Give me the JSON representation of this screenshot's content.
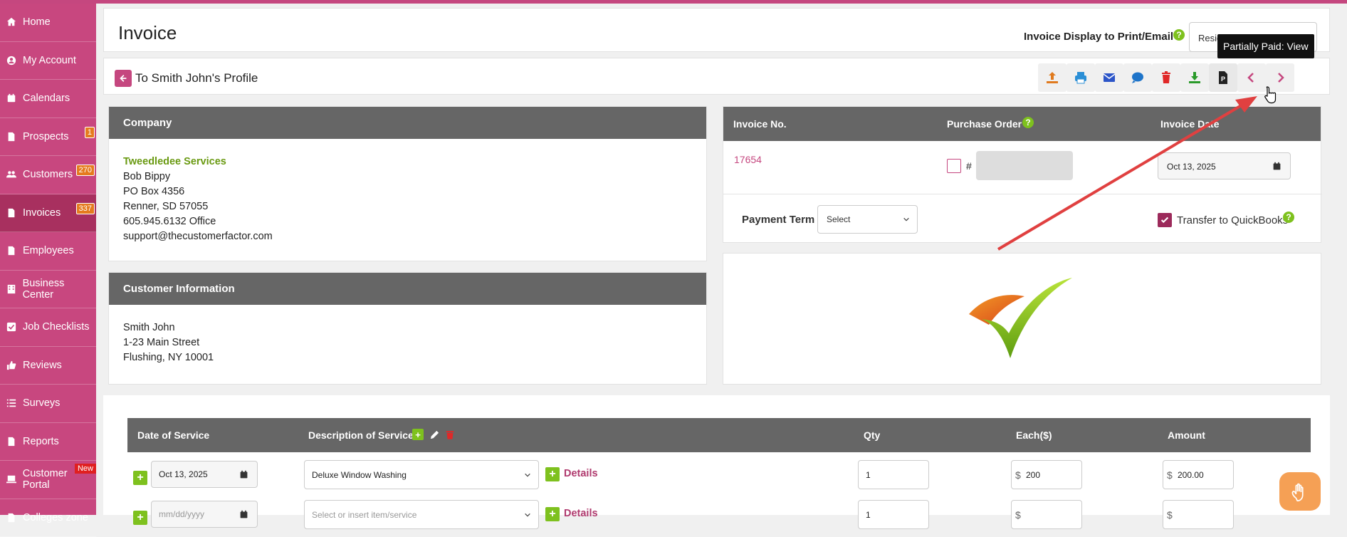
{
  "sidebar": {
    "items": [
      {
        "label": "Home",
        "icon": "home-icon"
      },
      {
        "label": "My Account",
        "icon": "user-circle-icon"
      },
      {
        "label": "Calendars",
        "icon": "calendar-icon"
      },
      {
        "label": "Prospects",
        "icon": "file-icon",
        "badge": "1"
      },
      {
        "label": "Customers",
        "icon": "users-icon",
        "badge": "270"
      },
      {
        "label": "Invoices",
        "icon": "file-icon",
        "badge": "337"
      },
      {
        "label": "Employees",
        "icon": "file-icon"
      },
      {
        "label": "Business Center",
        "icon": "building-icon"
      },
      {
        "label": "Job Checklists",
        "icon": "checkbox-icon"
      },
      {
        "label": "Reviews",
        "icon": "thumbs-up-icon"
      },
      {
        "label": "Surveys",
        "icon": "list-icon"
      },
      {
        "label": "Reports",
        "icon": "file-icon"
      },
      {
        "label": "Customer Portal",
        "icon": "laptop-icon",
        "badge": "New"
      },
      {
        "label": "Colleges zone",
        "icon": "file-icon"
      }
    ],
    "active": "Invoices"
  },
  "header": {
    "title": "Invoice",
    "display_label": "Invoice Display to Print/Email",
    "display_select": "Residential Invoice"
  },
  "nav": {
    "back_label": "To Smith John's Profile",
    "tooltip": "Partially Paid: View"
  },
  "company": {
    "heading": "Company",
    "name": "Tweedledee Services",
    "contact": "Bob Bippy",
    "line1": "PO Box 4356",
    "line2": "Renner, SD 57055",
    "phone": "605.945.6132 Office",
    "email": "support@thecustomerfactor.com"
  },
  "customer": {
    "heading": "Customer Information",
    "name": "Smith John",
    "line1": "1-23 Main Street",
    "line2": "Flushing, NY 10001"
  },
  "invoice": {
    "no_label": "Invoice No.",
    "po_label": "Purchase Order",
    "date_label": "Invoice Date",
    "number": "17654",
    "po_hash": "#",
    "date": "Oct 13, 2025",
    "payment_term_label": "Payment Term",
    "payment_term_value": "Select",
    "quickbooks_label": "Transfer to QuickBooks"
  },
  "services": {
    "col_date": "Date of Service",
    "col_desc": "Description of Service",
    "col_qty": "Qty",
    "col_each": "Each($)",
    "col_amount": "Amount",
    "rows": [
      {
        "date": "Oct 13, 2025",
        "description": "Deluxe Window Washing",
        "details": "Details",
        "qty": "1",
        "currency": "$",
        "each": "200",
        "amount": "200.00"
      },
      {
        "date_placeholder": "mm/dd/yyyy",
        "description_placeholder": "Select or insert item/service",
        "details": "Details",
        "qty": "1",
        "currency": "$",
        "each": "",
        "amount": ""
      }
    ]
  },
  "colors": {
    "brand": "#c8477f",
    "accent_green": "#7ec11e",
    "header_gray": "#666666",
    "badge_orange": "#e57b1e"
  }
}
